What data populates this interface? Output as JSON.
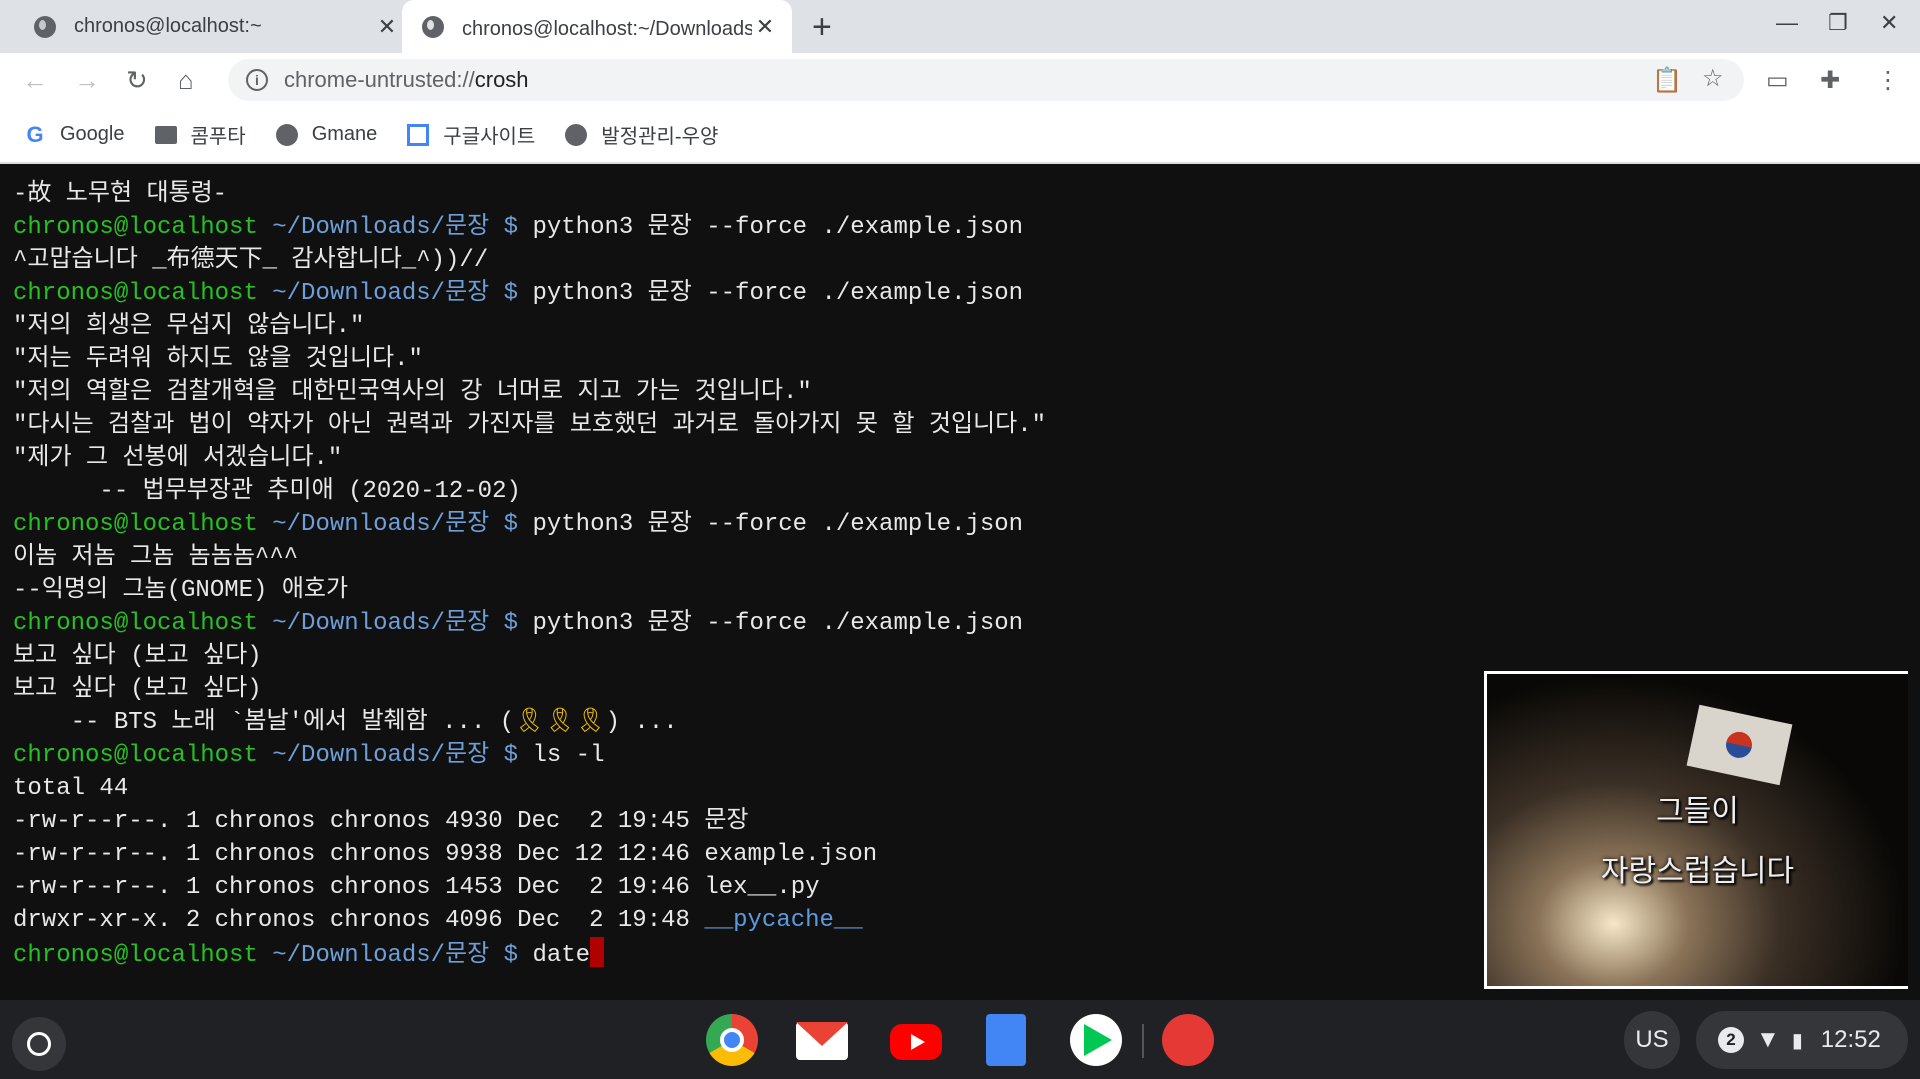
{
  "tabs": [
    {
      "title": "chronos@localhost:~",
      "active": false
    },
    {
      "title": "chronos@localhost:~/Downloads/문장",
      "active": true
    }
  ],
  "toolbar": {
    "url_prefix": "chrome-untrusted://",
    "url_host": "crosh"
  },
  "bookmarks": [
    {
      "label": "Google",
      "icon": "google-icon"
    },
    {
      "label": "콤푸타",
      "icon": "folder-icon"
    },
    {
      "label": "Gmane",
      "icon": "globe-icon"
    },
    {
      "label": "구글사이트",
      "icon": "sites-icon"
    },
    {
      "label": "발정관리-우양",
      "icon": "globe-icon"
    }
  ],
  "prompt": {
    "user": "chronos@localhost",
    "dir": "~/Downloads/문장 $"
  },
  "terminal": [
    {
      "t": "-故 노무현 대통령-"
    },
    {
      "cmd": "python3 문장 --force ./example.json"
    },
    {
      "t": "^고맙습니다 _布德天下_ 감사합니다_^))//"
    },
    {
      "cmd": "python3 문장 --force ./example.json"
    },
    {
      "t": "\"저의 희생은 무섭지 않습니다.\""
    },
    {
      "t": "\"저는 두려워 하지도 않을 것입니다.\""
    },
    {
      "t": "\"저의 역할은 검찰개혁을 대한민국역사의 강 너머로 지고 가는 것입니다.\""
    },
    {
      "t": "\"다시는 검찰과 법이 약자가 아닌 권력과 가진자를 보호했던 과거로 돌아가지 못 할 것입니다.\""
    },
    {
      "t": "\"제가 그 선봉에 서겠습니다.\""
    },
    {
      "t": "      -- 법무부장관 추미애 (2020-12-02)"
    },
    {
      "cmd": "python3 문장 --force ./example.json"
    },
    {
      "t": "이놈 저놈 그놈 놈놈놈^^^"
    },
    {
      "t": "--익명의 그놈(GNOME) 애호가"
    },
    {
      "cmd": "python3 문장 --force ./example.json"
    },
    {
      "t": "보고 싶다 (보고 싶다)"
    },
    {
      "t": "보고 싶다 (보고 싶다)"
    },
    {
      "t": "    -- BTS 노래 `봄날'에서 발췌함 ... (",
      "rib": "🎗🎗🎗",
      "t2": ") ..."
    },
    {
      "cmd": "ls -l"
    },
    {
      "t": "total 44"
    },
    {
      "t": "-rw-r--r--. 1 chronos chronos 4930 Dec  2 19:45 문장"
    },
    {
      "t": "-rw-r--r--. 1 chronos chronos 9938 Dec 12 12:46 example.json"
    },
    {
      "t": "-rw-r--r--. 1 chronos chronos 1453 Dec  2 19:46 lex__.py"
    },
    {
      "t": "drwxr-xr-x. 2 chronos chronos 4096 Dec  2 19:48 ",
      "dir": "__pycache__"
    },
    {
      "cmd": "date",
      "cursor": true
    }
  ],
  "video": {
    "line1": "그들이",
    "line2": "자랑스럽습니다"
  },
  "shelf": {
    "apps": [
      "chrome",
      "gmail",
      "youtube",
      "docs",
      "play-store",
      "screen-recorder"
    ],
    "ime": "US",
    "notifications": "2",
    "time": "12:52"
  },
  "colors": {
    "prompt_user": "#25c222",
    "prompt_dir": "#6e9fd8",
    "cursor": "#b00000"
  }
}
